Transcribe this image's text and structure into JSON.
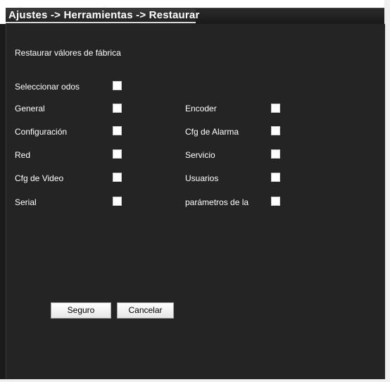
{
  "header": {
    "title": "Ajustes -> Herramientas -> Restaurar"
  },
  "section": {
    "heading": "Restaurar válores de fábrica"
  },
  "options": {
    "select_all": "Seleccionar odos",
    "left": [
      "General",
      "Configuración",
      "Red",
      "Cfg de Video",
      "Serial"
    ],
    "right": [
      "Encoder",
      "Cfg de Alarma",
      "Servicio",
      "Usuarios",
      "parámetros de la"
    ]
  },
  "buttons": {
    "ok_label": "Seguro",
    "cancel_label": "Cancelar"
  },
  "colors": {
    "panel_background": "#242424",
    "text": "#ffffff",
    "checkbox": "#ffffff"
  }
}
